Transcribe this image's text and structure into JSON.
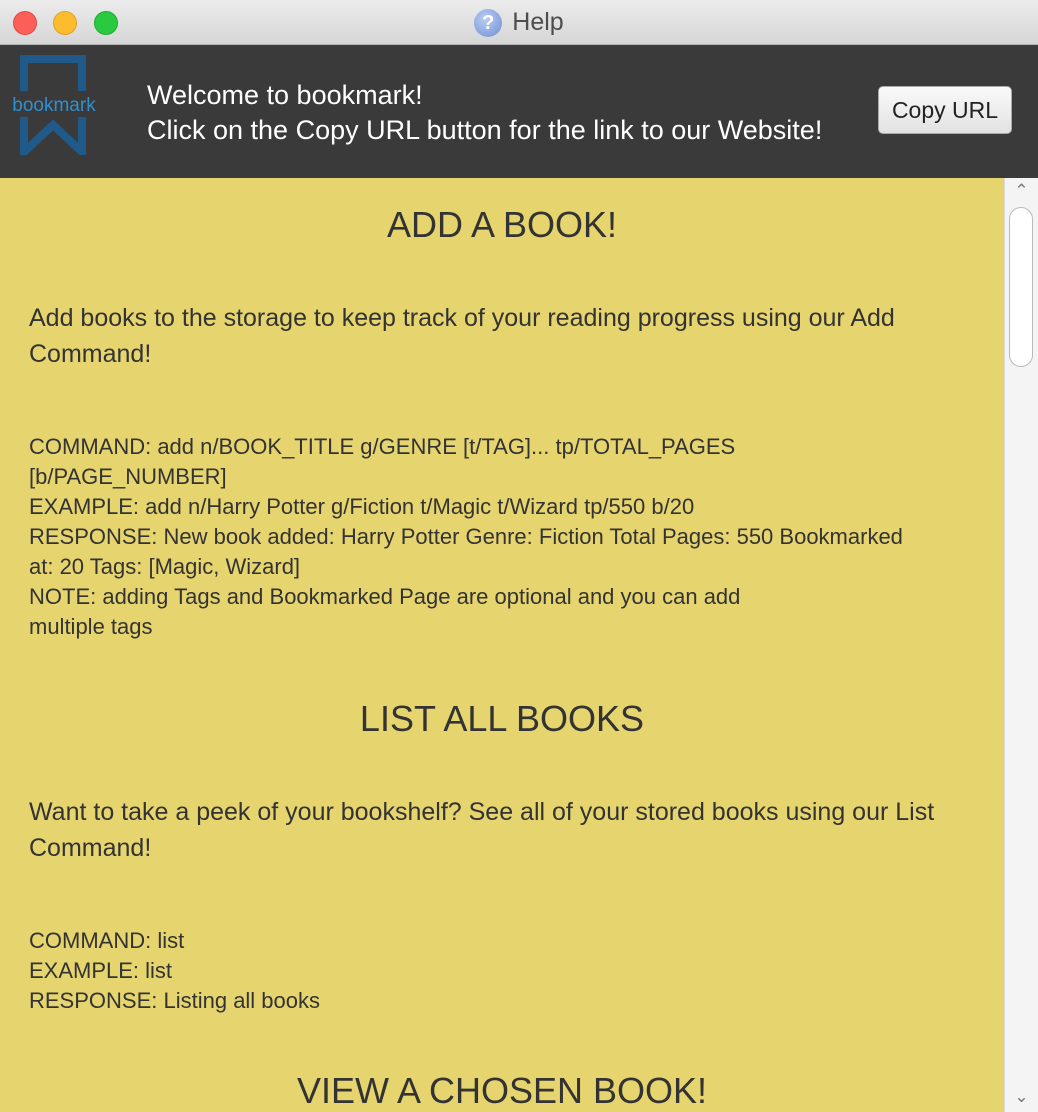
{
  "window": {
    "title": "Help"
  },
  "header": {
    "logo_text": "bookmark",
    "welcome_line1": "Welcome to bookmark!",
    "welcome_line2": "Click on the Copy URL button for the link to our Website!",
    "copy_button": "Copy URL"
  },
  "sections": [
    {
      "heading": "ADD A BOOK!",
      "description": "Add books to the storage to keep track of your reading progress using our Add Command!",
      "lines": [
        "COMMAND: add n/BOOK_TITLE g/GENRE [t/TAG]... tp/TOTAL_PAGES",
        "[b/PAGE_NUMBER]",
        "EXAMPLE: add n/Harry Potter g/Fiction t/Magic t/Wizard tp/550 b/20",
        "RESPONSE: New book added: Harry Potter Genre: Fiction Total Pages: 550 Bookmarked",
        "at: 20 Tags: [Magic, Wizard]",
        "NOTE: adding Tags and Bookmarked Page are optional and you can add",
        "multiple tags"
      ]
    },
    {
      "heading": "LIST ALL BOOKS",
      "description": "Want to take a peek of your bookshelf? See all of your stored books using our List Command!",
      "lines": [
        "COMMAND: list",
        "EXAMPLE: list",
        "RESPONSE: Listing all books"
      ]
    },
    {
      "heading": "VIEW A CHOSEN BOOK!"
    }
  ],
  "colors": {
    "header_bg": "#3a3a3a",
    "content_bg": "#e6d46f",
    "logo_blue": "#1f5a8a"
  },
  "icons": {
    "title": "help-icon",
    "logo": "bookmark-logo-icon",
    "scroll_up": "chevron-up-icon",
    "scroll_down": "chevron-down-icon"
  }
}
